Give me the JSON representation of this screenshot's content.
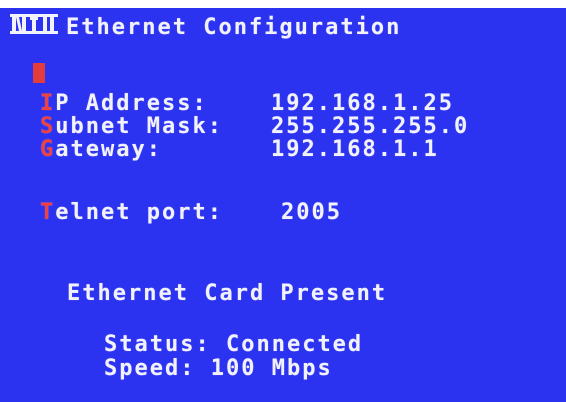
{
  "header": {
    "logo_text": "NTI",
    "title": "Ethernet Configuration"
  },
  "fields": {
    "ip_address": {
      "hotkey": "I",
      "label_rest": "P Address:",
      "value": "192.168.1.25"
    },
    "subnet_mask": {
      "hotkey": "S",
      "label_rest": "ubnet Mask:",
      "value": "255.255.255.0"
    },
    "gateway": {
      "hotkey": "G",
      "label_rest": "ateway:",
      "value": "192.168.1.1"
    },
    "telnet_port": {
      "hotkey": "T",
      "label_rest": "elnet port:",
      "value": "2005"
    }
  },
  "card": {
    "heading": "Ethernet Card Present",
    "status_label": "Status:",
    "status_value": "Connected",
    "speed_label": "Speed:",
    "speed_value": "100 Mbps"
  },
  "colors": {
    "background": "#2b32f0",
    "text": "#f2f2ff",
    "hotkey": "#f04040",
    "cursor": "#e23c3c"
  }
}
